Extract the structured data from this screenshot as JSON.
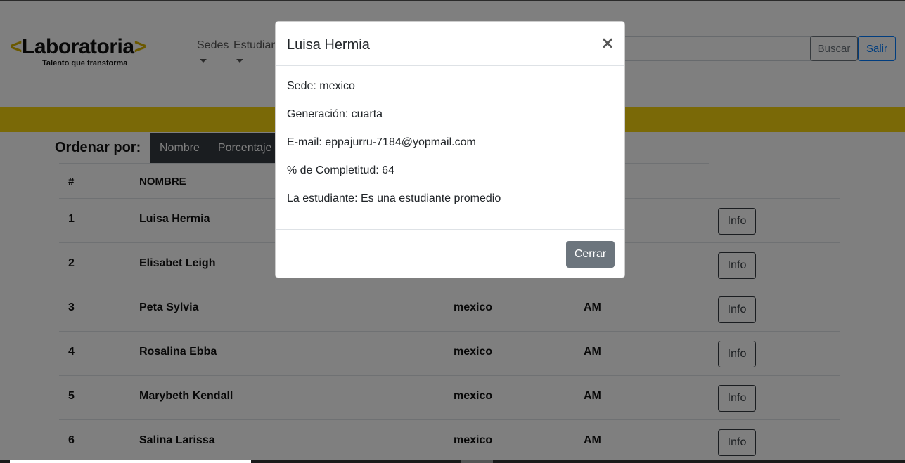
{
  "brand": {
    "left_bracket": "<",
    "name": "Laboratoria",
    "right_bracket": ">",
    "tagline": "Talento que transforma"
  },
  "nav": {
    "items": [
      {
        "label": "Sedes"
      },
      {
        "label": "Estudiant"
      }
    ],
    "search_value": "",
    "buscar_label": "Buscar",
    "salir_label": "Salir"
  },
  "order": {
    "label": "Ordenar por:",
    "options": [
      {
        "label": "Nombre"
      },
      {
        "label": "Porcentaje"
      }
    ]
  },
  "table": {
    "headers": {
      "num": "#",
      "name": "NOMBRE"
    },
    "info_label": "Info",
    "rows": [
      {
        "num": "1",
        "name": "Luisa Hermia",
        "sede": "",
        "turno": ""
      },
      {
        "num": "2",
        "name": "Elisabet Leigh",
        "sede": "",
        "turno": ""
      },
      {
        "num": "3",
        "name": "Peta Sylvia",
        "sede": "mexico",
        "turno": "AM"
      },
      {
        "num": "4",
        "name": "Rosalina Ebba",
        "sede": "mexico",
        "turno": "AM"
      },
      {
        "num": "5",
        "name": "Marybeth Kendall",
        "sede": "mexico",
        "turno": "AM"
      },
      {
        "num": "6",
        "name": "Salina Larissa",
        "sede": "mexico",
        "turno": "AM"
      }
    ]
  },
  "modal": {
    "title": "Luisa Hermia",
    "close_symbol": "×",
    "lines": [
      "Sede: mexico",
      "Generación: cuarta",
      "E-mail: eppajurru-7184@yopmail.com",
      "% de Completitud: 64",
      "La estudiante: Es una estudiante promedio"
    ],
    "cerrar_label": "Cerrar"
  },
  "colors": {
    "brand_yellow": "#f5d20f",
    "dark": "#343a40",
    "secondary": "#6c757d",
    "primary": "#007bff"
  }
}
